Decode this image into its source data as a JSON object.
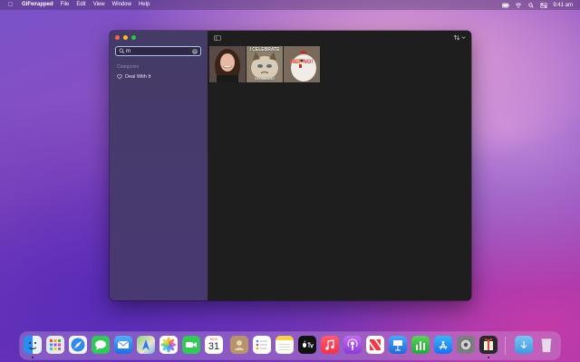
{
  "menubar": {
    "app_name": "GIFwrapped",
    "items": [
      "File",
      "Edit",
      "View",
      "Window",
      "Help"
    ],
    "clock": "9:41 am"
  },
  "window": {
    "search": {
      "value": "m"
    },
    "sidebar": {
      "section_heading": "Categories",
      "items": [
        {
          "label": "Deal With It",
          "icon": "heart-icon"
        }
      ]
    },
    "gifs": [
      {
        "name": "gif-woman-smiling",
        "caption": ""
      },
      {
        "name": "gif-grumpy-cat",
        "caption": "I CELEBRATE",
        "caption_bottom": "NOT BEING"
      },
      {
        "name": "gif-chicken",
        "caption": "NET NO!"
      }
    ]
  },
  "dock": {
    "calendar_month": "NOV",
    "calendar_day": "31",
    "icons": [
      "finder-icon",
      "launchpad-icon",
      "safari-icon",
      "messages-icon",
      "mail-icon",
      "maps-icon",
      "photos-icon",
      "facetime-icon",
      "calendar-icon",
      "contacts-icon",
      "reminders-icon",
      "notes-icon",
      "tv-icon",
      "music-icon",
      "podcasts-icon",
      "news-icon",
      "keynote-icon",
      "numbers-icon",
      "app-store-icon",
      "system-preferences-icon",
      "gifwrapped-icon",
      "downloads-folder-icon",
      "trash-icon"
    ]
  },
  "colors": {
    "accent_blue": "#a9c7ea",
    "close": "#ff5f57",
    "minimize": "#febc2e",
    "maximize": "#28c840"
  }
}
